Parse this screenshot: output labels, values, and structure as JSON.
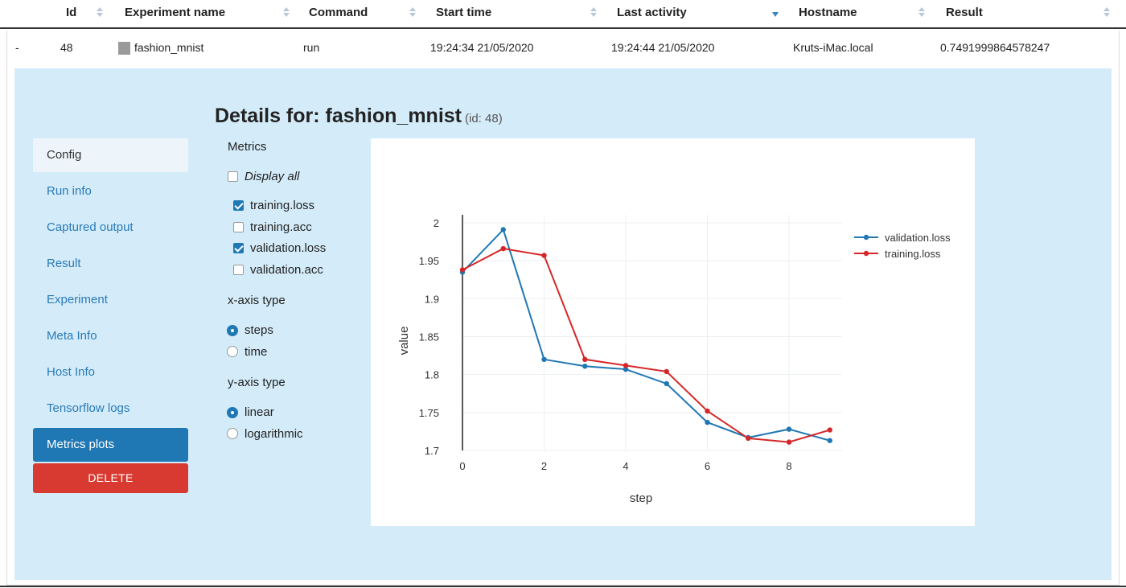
{
  "table": {
    "headers": [
      "Id",
      "Experiment name",
      "Command",
      "Start time",
      "Last activity",
      "Hostname",
      "Result"
    ],
    "sort_column": "Last activity",
    "row": {
      "expand": "-",
      "id": "48",
      "experiment_name": "fashion_mnist",
      "command": "run",
      "start_time": "19:24:34 21/05/2020",
      "last_activity": "19:24:44 21/05/2020",
      "hostname": "Kruts-iMac.local",
      "result": "0.7491999864578247"
    }
  },
  "details": {
    "title": "Details for: fashion_mnist",
    "id_note": "(id: 48)"
  },
  "nav": {
    "items": [
      "Config",
      "Run info",
      "Captured output",
      "Result",
      "Experiment",
      "Meta Info",
      "Host Info",
      "Tensorflow logs",
      "Metrics plots"
    ],
    "active": "Metrics plots",
    "delete_label": "DELETE"
  },
  "controls": {
    "metrics_label": "Metrics",
    "display_all": {
      "label": "Display all",
      "checked": false
    },
    "metrics": [
      {
        "label": "training.loss",
        "checked": true
      },
      {
        "label": "training.acc",
        "checked": false
      },
      {
        "label": "validation.loss",
        "checked": true
      },
      {
        "label": "validation.acc",
        "checked": false
      }
    ],
    "xaxis_label": "x-axis type",
    "xaxis_options": [
      {
        "label": "steps",
        "checked": true
      },
      {
        "label": "time",
        "checked": false
      }
    ],
    "yaxis_label": "y-axis type",
    "yaxis_options": [
      {
        "label": "linear",
        "checked": true
      },
      {
        "label": "logarithmic",
        "checked": false
      }
    ]
  },
  "colors": {
    "accent": "#1f78b4",
    "delete": "#d83a31",
    "panel_bg": "#d4ecf9",
    "validation_loss": "#1f77b4",
    "training_loss": "#d62728"
  },
  "chart_data": {
    "type": "line",
    "xlabel": "step",
    "ylabel": "value",
    "xlim": [
      0,
      9.3
    ],
    "ylim": [
      1.7,
      2.0
    ],
    "xticks": [
      0,
      2,
      4,
      6,
      8
    ],
    "yticks": [
      1.7,
      1.75,
      1.8,
      1.85,
      1.9,
      1.95,
      2
    ],
    "ytick_labels": [
      "1.7",
      "1.75",
      "1.8",
      "1.85",
      "1.9",
      "1.95",
      "2"
    ],
    "grid": true,
    "legend_position": "top-right",
    "series": [
      {
        "name": "validation.loss",
        "color": "#1f77b4",
        "x": [
          0,
          1,
          2,
          3,
          4,
          5,
          6,
          7,
          8,
          9
        ],
        "y": [
          1.935,
          1.991,
          1.82,
          1.811,
          1.807,
          1.788,
          1.737,
          1.717,
          1.728,
          1.713
        ]
      },
      {
        "name": "training.loss",
        "color": "#d62728",
        "x": [
          0,
          1,
          2,
          3,
          4,
          5,
          6,
          7,
          8,
          9
        ],
        "y": [
          1.938,
          1.966,
          1.957,
          1.82,
          1.812,
          1.804,
          1.752,
          1.716,
          1.711,
          1.727
        ]
      }
    ]
  }
}
